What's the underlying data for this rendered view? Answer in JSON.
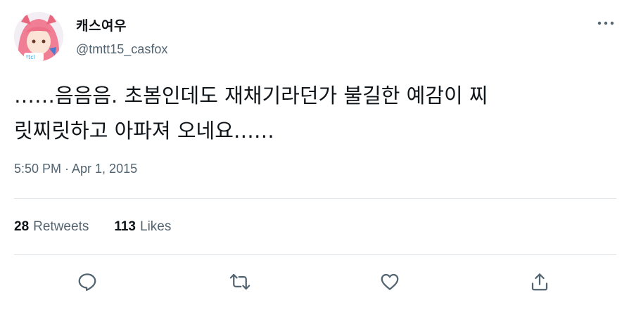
{
  "author": {
    "display_name": "캐스여우",
    "handle": "@tmtt15_casfox"
  },
  "tweet": {
    "text": "……음음음. 초봄인데도 재채기라던가 불길한 예감이 찌\n릿찌릿하고 아파져 오네요……",
    "timestamp": "5:50 PM · Apr 1, 2015"
  },
  "stats": {
    "retweets_count": "28",
    "retweets_label": "Retweets",
    "likes_count": "113",
    "likes_label": "Likes"
  },
  "icons": {
    "more": "more-dots-icon",
    "reply": "reply-bubble-icon",
    "retweet": "retweet-arrows-icon",
    "like": "heart-icon",
    "share": "share-upload-icon"
  },
  "colors": {
    "text_primary": "#0f1419",
    "text_secondary": "#536471",
    "divider": "#e1e6ea"
  }
}
